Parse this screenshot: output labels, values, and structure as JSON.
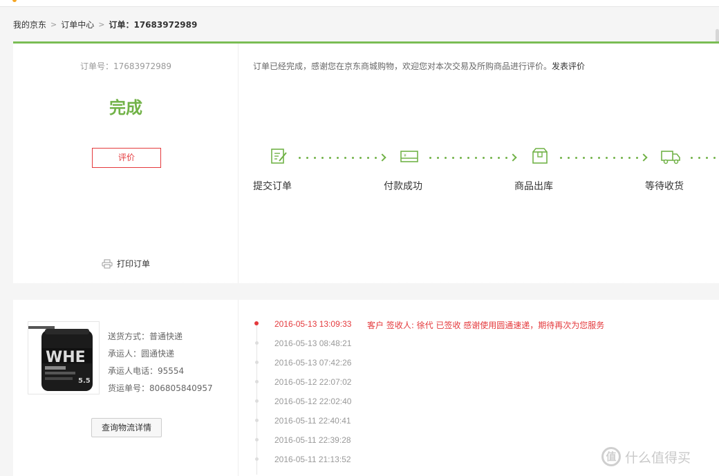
{
  "breadcrumb": {
    "home": "我的京东",
    "order_center": "订单中心",
    "current": "订单：17683972989"
  },
  "status": {
    "order_no": "订单号：17683972989",
    "state": "完成",
    "review_button": "评价",
    "print_label": "打印订单",
    "notice": "订单已经完成，感谢您在京东商城购物，欢迎您对本次交易及所购商品进行评价。",
    "notice_link": "发表评价",
    "accent_color": "#71b247",
    "alert_color": "#e4393c"
  },
  "steps": [
    {
      "label": "提交订单",
      "icon": "edit-form-icon"
    },
    {
      "label": "付款成功",
      "icon": "credit-card-icon"
    },
    {
      "label": "商品出库",
      "icon": "package-box-icon"
    },
    {
      "label": "等待收货",
      "icon": "delivery-truck-icon"
    }
  ],
  "shipping": {
    "method_label": "送货方式：",
    "method": "普通快递",
    "carrier_label": "承运人：",
    "carrier": "圆通快递",
    "phone_label": "承运人电话：",
    "phone": "95554",
    "tracking_label": "货运单号：",
    "tracking": "806805840957",
    "track_button": "查询物流详情",
    "product_image": "whey-protein-tub-image"
  },
  "timeline": [
    {
      "time": "2016-05-13 13:09:33",
      "desc": "客户 签收人: 徐代 已签收 感谢使用圆通速递，期待再次为您服务",
      "active": true
    },
    {
      "time": "2016-05-13 08:48:21",
      "desc": "",
      "active": false
    },
    {
      "time": "2016-05-13 07:42:26",
      "desc": "",
      "active": false
    },
    {
      "time": "2016-05-12 22:07:02",
      "desc": "",
      "active": false
    },
    {
      "time": "2016-05-12 22:02:40",
      "desc": "",
      "active": false
    },
    {
      "time": "2016-05-11 22:40:41",
      "desc": "",
      "active": false
    },
    {
      "time": "2016-05-11 22:39:28",
      "desc": "",
      "active": false
    },
    {
      "time": "2016-05-11 21:13:52",
      "desc": "",
      "active": false
    }
  ],
  "watermark": {
    "logo": "值",
    "text": "什么值得买"
  }
}
